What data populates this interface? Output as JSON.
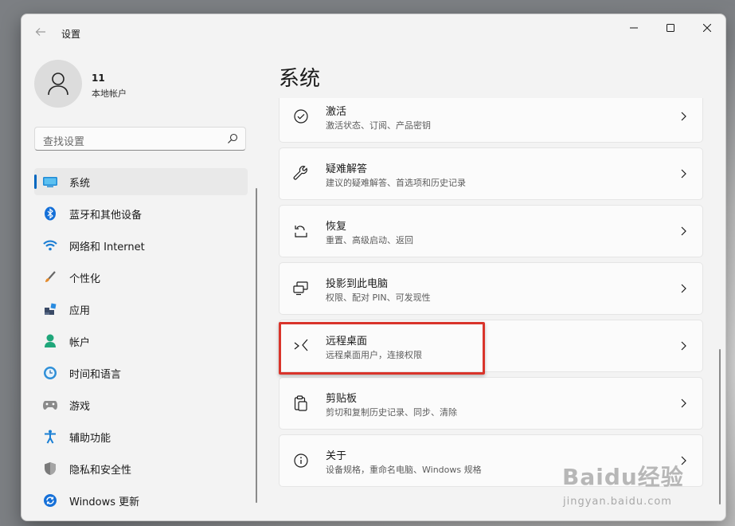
{
  "window": {
    "title": "设置",
    "back_icon": "arrow-left-icon",
    "controls": [
      "minimize-icon",
      "maximize-icon",
      "close-icon"
    ]
  },
  "profile": {
    "name": "11",
    "account_type": "本地帐户"
  },
  "search": {
    "placeholder": "查找设置"
  },
  "sidebar": {
    "items": [
      {
        "label": "系统",
        "icon": "display-icon",
        "selected": true
      },
      {
        "label": "蓝牙和其他设备",
        "icon": "bluetooth-icon"
      },
      {
        "label": "网络和 Internet",
        "icon": "wifi-icon"
      },
      {
        "label": "个性化",
        "icon": "paintbrush-icon"
      },
      {
        "label": "应用",
        "icon": "apps-icon"
      },
      {
        "label": "帐户",
        "icon": "person-icon"
      },
      {
        "label": "时间和语言",
        "icon": "clock-globe-icon"
      },
      {
        "label": "游戏",
        "icon": "gamepad-icon"
      },
      {
        "label": "辅助功能",
        "icon": "accessibility-icon"
      },
      {
        "label": "隐私和安全性",
        "icon": "shield-icon"
      },
      {
        "label": "Windows 更新",
        "icon": "update-icon"
      }
    ]
  },
  "page": {
    "title": "系统"
  },
  "settings": [
    {
      "title": "激活",
      "subtitle": "激活状态、订阅、产品密钥",
      "icon": "check-circle-icon"
    },
    {
      "title": "疑难解答",
      "subtitle": "建议的疑难解答、首选项和历史记录",
      "icon": "wrench-icon"
    },
    {
      "title": "恢复",
      "subtitle": "重置、高级启动、返回",
      "icon": "recovery-icon"
    },
    {
      "title": "投影到此电脑",
      "subtitle": "权限、配对 PIN、可发现性",
      "icon": "projection-icon"
    },
    {
      "title": "远程桌面",
      "subtitle": "远程桌面用户，连接权限",
      "icon": "remote-desktop-icon",
      "highlighted": true
    },
    {
      "title": "剪贴板",
      "subtitle": "剪切和复制历史记录、同步、清除",
      "icon": "clipboard-icon"
    },
    {
      "title": "关于",
      "subtitle": "设备规格，重命名电脑、Windows 规格",
      "icon": "info-icon"
    }
  ],
  "watermark": {
    "logo": "Baidu经验",
    "url": "jingyan.baidu.com"
  },
  "colors": {
    "accent": "#0067c0",
    "highlight": "#d9342b"
  }
}
